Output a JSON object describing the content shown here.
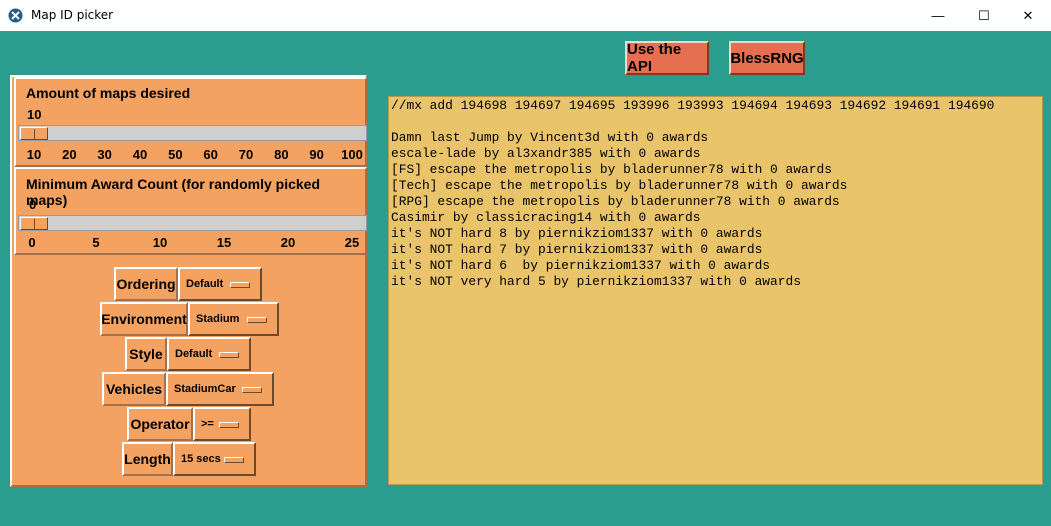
{
  "window": {
    "title": "Map ID picker",
    "controls": [
      "—",
      "☐",
      "✕"
    ]
  },
  "buttons": {
    "api": "Use the API",
    "bless": "BlessRNG"
  },
  "amount_scale": {
    "label": "Amount of maps desired",
    "value": "10",
    "fraction": 0,
    "ticks": [
      "10",
      "20",
      "30",
      "40",
      "50",
      "60",
      "70",
      "80",
      "90",
      "100"
    ]
  },
  "award_scale": {
    "label": "Minimum Award Count (for randomly picked maps)",
    "value": "0",
    "fraction": 0,
    "ticks": [
      "0",
      "5",
      "10",
      "15",
      "20",
      "25"
    ]
  },
  "options": [
    {
      "label": "Ordering",
      "value": "Default"
    },
    {
      "label": "Environment",
      "value": "Stadium"
    },
    {
      "label": "Style",
      "value": "Default"
    },
    {
      "label": "Vehicles",
      "value": "StadiumCar"
    },
    {
      "label": "Operator",
      "value": ">="
    },
    {
      "label": "Length",
      "value": "15 secs"
    }
  ],
  "output": {
    "lines": [
      "//mx add 194698 194697 194695 193996 193993 194694 194693 194692 194691 194690",
      "",
      "Damn last Jump by Vincent3d with 0 awards",
      "escale-lade by al3xandr385 with 0 awards",
      "[FS] escape the metropolis by bladerunner78 with 0 awards",
      "[Tech] escape the metropolis by bladerunner78 with 0 awards",
      "[RPG] escape the metropolis by bladerunner78 with 0 awards",
      "Casimir by classicracing14 with 0 awards",
      "it's NOT hard 8 by piernikziom1337 with 0 awards",
      "it's NOT hard 7 by piernikziom1337 with 0 awards",
      "it's NOT hard 6  by piernikziom1337 with 0 awards",
      "it's NOT very hard 5 by piernikziom1337 with 0 awards"
    ]
  }
}
